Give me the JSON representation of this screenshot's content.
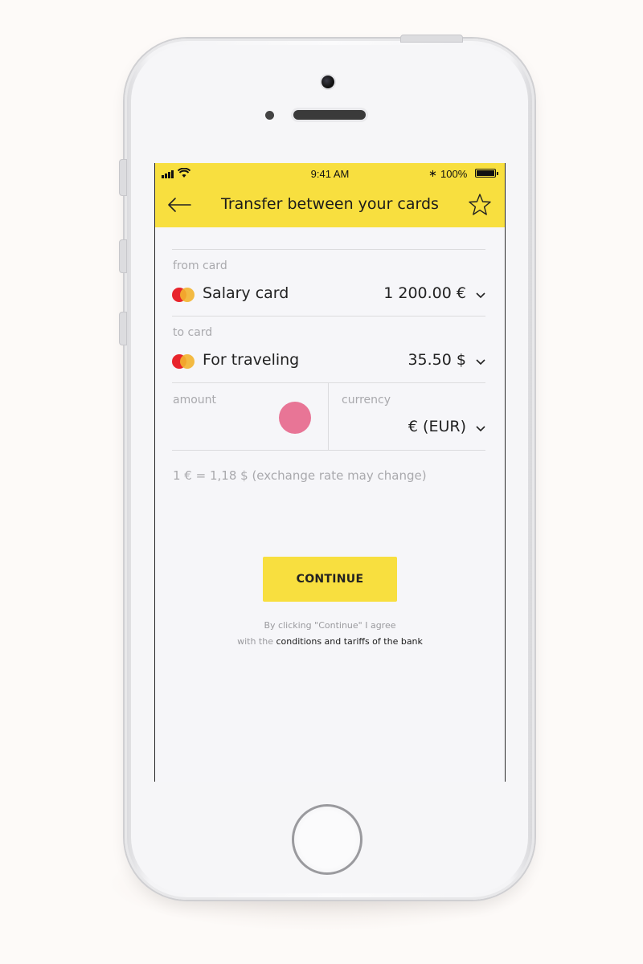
{
  "status_bar": {
    "time": "9:41 AM",
    "battery": "100%",
    "bluetooth": "bluetooth-icon",
    "wifi": "wifi-icon",
    "signal": "signal-icon"
  },
  "header": {
    "title": "Transfer between your cards",
    "back_icon": "back-arrow-icon",
    "favorite_icon": "star-icon"
  },
  "from_card": {
    "label": "from card",
    "name": "Salary card",
    "balance": "1 200.00 €"
  },
  "to_card": {
    "label": "to card",
    "name": "For traveling",
    "balance": "35.50 $"
  },
  "amount": {
    "label": "amount",
    "value": ""
  },
  "currency": {
    "label": "currency",
    "value": "€ (EUR)"
  },
  "exchange_rate": "1 € = 1,18 $ (exchange rate may change)",
  "continue_label": "CONTINUE",
  "agreement": {
    "line1": "By clicking \"Continue\" I agree",
    "line2_prefix": "with the",
    "line2_link": "conditions and tariffs of the bank"
  },
  "colors": {
    "accent": "#f8df3f",
    "touch_indicator": "#e87596",
    "card_red": "#e8242c",
    "card_yellow": "#f3b42d"
  }
}
